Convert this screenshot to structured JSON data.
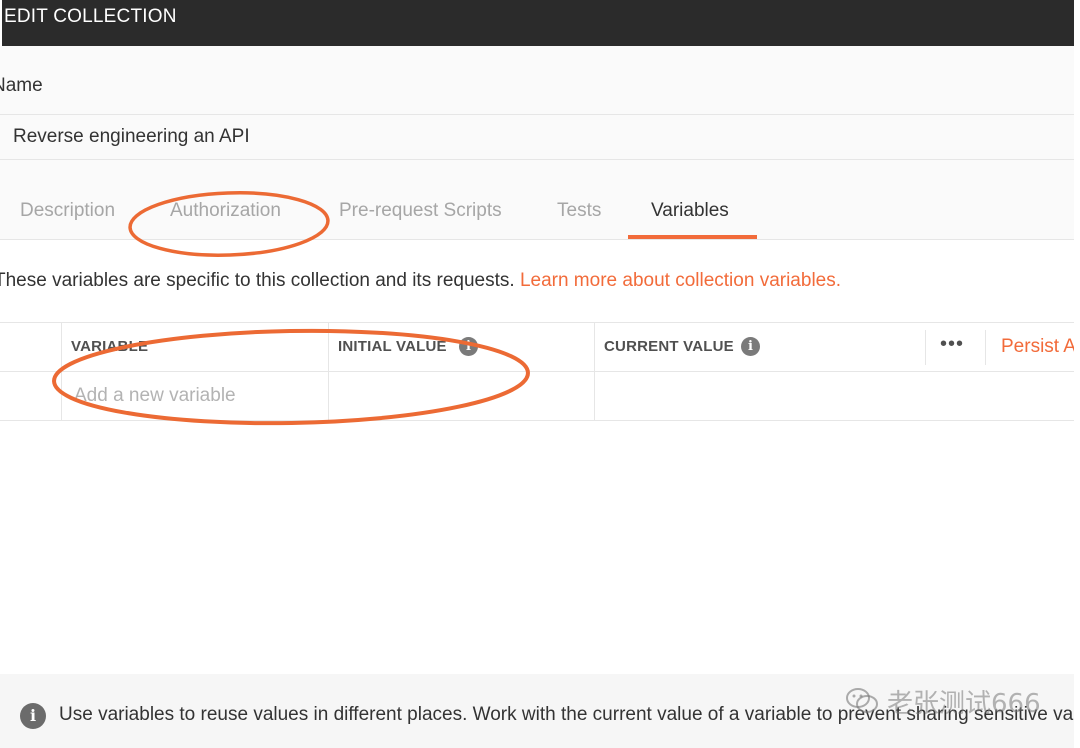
{
  "header": {
    "title": "EDIT COLLECTION"
  },
  "name": {
    "label": "Name",
    "value": "Reverse engineering an API"
  },
  "tabs": [
    {
      "label": "Description",
      "active": false
    },
    {
      "label": "Authorization",
      "active": false
    },
    {
      "label": "Pre-request Scripts",
      "active": false
    },
    {
      "label": "Tests",
      "active": false
    },
    {
      "label": "Variables",
      "active": true
    }
  ],
  "info": {
    "text": "These variables are specific to this collection and its requests. ",
    "link": "Learn more about collection variables."
  },
  "table": {
    "headers": {
      "variable": "VARIABLE",
      "initial_value": "INITIAL VALUE",
      "current_value": "CURRENT VALUE",
      "more": "•••",
      "persist": "Persist All"
    },
    "new_row": {
      "variable_placeholder": "Add a new variable",
      "initial_value": "",
      "current_value": ""
    }
  },
  "footer": {
    "text": "Use variables to reuse values in different places. Work with the current value of a variable to prevent sharing sensitive values."
  },
  "watermark": {
    "text": "老张测试666"
  },
  "colors": {
    "accent": "#f26b3a",
    "header_bg": "#2b2b2b",
    "annotation": "#ec6a34"
  },
  "icons": {
    "info": "info-icon",
    "more": "more-horizontal-icon",
    "wechat": "wechat-icon"
  }
}
